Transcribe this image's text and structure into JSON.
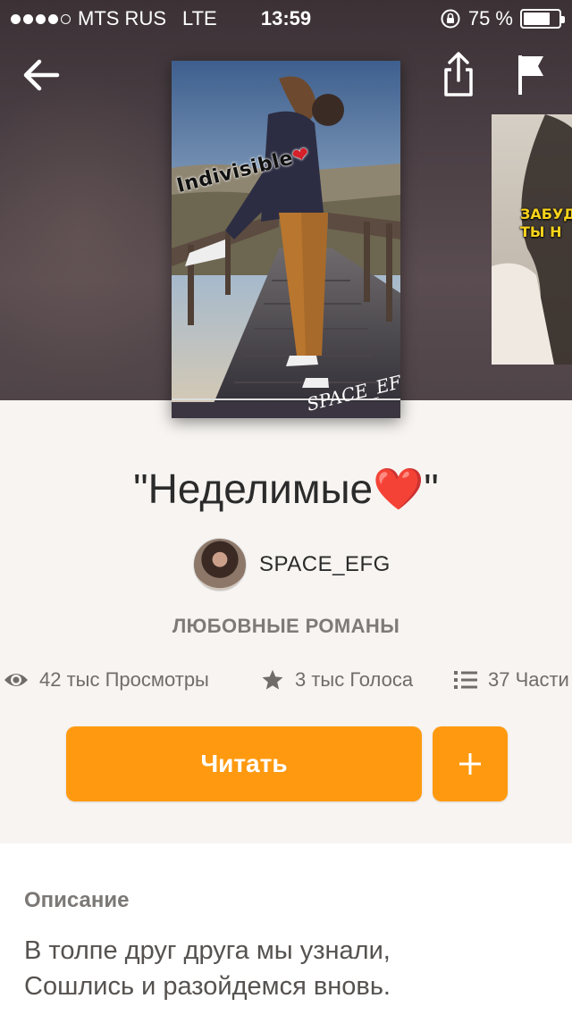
{
  "status_bar": {
    "carrier": "MTS RUS",
    "network": "LTE",
    "time": "13:59",
    "battery": "75 %",
    "battery_level": 0.75,
    "signal_bars_filled": 4,
    "signal_bars_total": 5
  },
  "nav": {
    "back_icon": "back-arrow-icon",
    "share_icon": "share-icon",
    "report_icon": "flag-icon"
  },
  "cover": {
    "overlay_text": "Indivisible",
    "signature": "SPACE_EF"
  },
  "next_cover": {
    "overlay_text_line1": "ЗАБУДЬ",
    "overlay_text_line2": "ТЫ Н"
  },
  "story": {
    "title": "\"Неделимые❤️\"",
    "author": "SPACE_EFG",
    "genre": "ЛЮБОВНЫЕ РОМАНЫ"
  },
  "stats": {
    "views": "42 тыс Просмотры",
    "votes": "3 тыс Голоса",
    "parts": "37 Части"
  },
  "actions": {
    "read_label": "Читать",
    "add_icon": "plus-icon"
  },
  "description": {
    "heading": "Описание",
    "lines": [
      "В толпе друг друга мы узнали,",
      "Сошлись и разойдемся вновь."
    ]
  },
  "colors": {
    "accent": "#ff9a10",
    "hero_bg": "#4a3f44",
    "page_bg": "#f7f4f1"
  }
}
